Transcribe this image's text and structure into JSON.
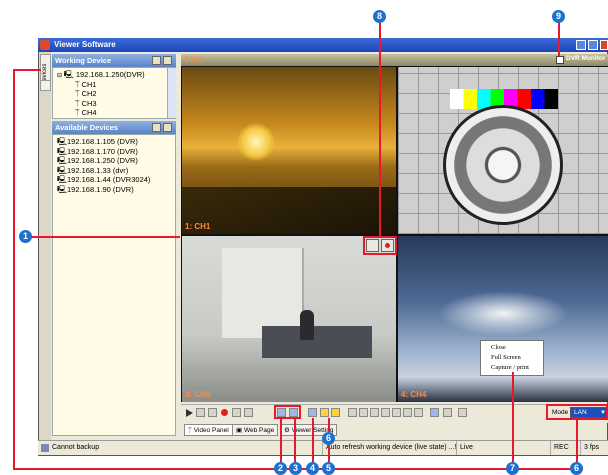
{
  "window": {
    "title": "Viewer Software"
  },
  "side_tabs": [
    "Devices"
  ],
  "working_device": {
    "header": "Working Device",
    "root": "192.168.1.250(DVR)",
    "channels": [
      "CH1",
      "CH2",
      "CH3",
      "CH4"
    ]
  },
  "available_devices": {
    "header": "Available Devices",
    "items": [
      "192.168.1.105 (DVR)",
      "192.168.1.170 (DVR)",
      "192.168.1.250 (DVR)",
      "192.168.1.33 (dvr)",
      "192.168.1.44 (DVR3024)",
      "192.168.1.90 (DVR)"
    ]
  },
  "video": {
    "mode_label": "Live",
    "monitor_label": "DVR Monitor",
    "tiles": [
      {
        "label": "1: CH1"
      },
      {
        "label": ""
      },
      {
        "label": "3: CH3"
      },
      {
        "label": "4: CH4"
      }
    ]
  },
  "context_menu": [
    "Close",
    "Full Screen",
    "Capture / print"
  ],
  "toolbar": {
    "mode_label": "Mode",
    "mode_value": "LAN"
  },
  "tabs": [
    "Video Panel",
    "Web Page",
    "Viewer Setting"
  ],
  "status": {
    "left": "Cannot backup",
    "message": "Auto refresh working device (live state) ...!",
    "state": "Live",
    "rec": "REC",
    "fps": "3 fps"
  },
  "callouts": [
    "1",
    "2",
    "3",
    "4",
    "5",
    "6",
    "7",
    "8",
    "9"
  ],
  "colors": {
    "accent": "#1f6fcf",
    "annotation": "#e8192c",
    "title_bar": "#1d46b8"
  }
}
